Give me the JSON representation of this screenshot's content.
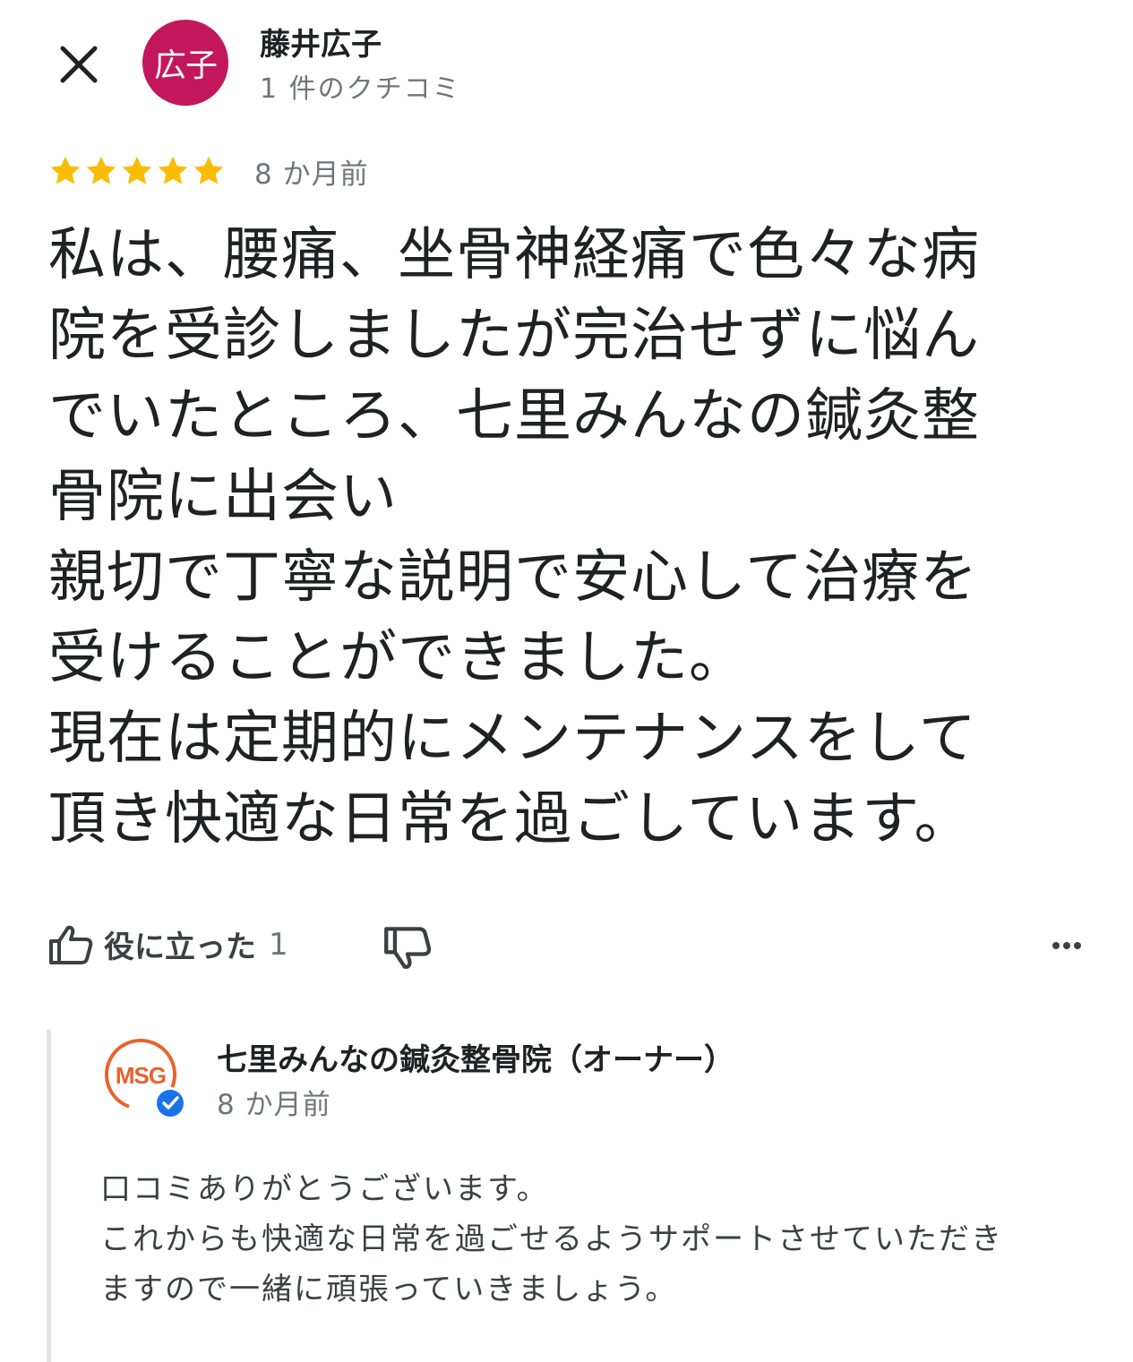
{
  "header": {
    "close_icon": "close-icon",
    "avatar_text": "広子",
    "avatar_color": "#c2185b",
    "reviewer_name": "藤井広子",
    "reviewer_review_count": "1 件のクチコミ"
  },
  "review": {
    "rating": 5,
    "rating_max": 5,
    "star_color": "#fbbc04",
    "date": "8 か月前",
    "lines": [
      "私は、腰痛、坐骨神経痛で色々な病",
      "院を受診しましたが完治せずに悩ん",
      "でいたところ、七里みんなの鍼灸整",
      "骨院に出会い",
      "親切で丁寧な説明で安心して治療を",
      "受けることができました。",
      "現在は定期的にメンテナンスをして",
      "頂き快適な日常を過ごしています。"
    ]
  },
  "actions": {
    "helpful_icon": "thumbs-up-icon",
    "helpful_label": "役に立った",
    "helpful_count": "1",
    "dislike_icon": "thumbs-down-icon",
    "more_icon": "more-horizontal-icon"
  },
  "owner_reply": {
    "logo_text": "MSG",
    "logo_color": "#e8622c",
    "verified_badge_color": "#1a73e8",
    "name": "七里みんなの鍼灸整骨院（オーナー）",
    "date": "8 か月前",
    "lines": [
      "口コミありがとうございます。",
      "これからも快適な日常を過ごせるようサポートさせていただき",
      "ますので一緒に頑張っていきましょう。"
    ]
  }
}
